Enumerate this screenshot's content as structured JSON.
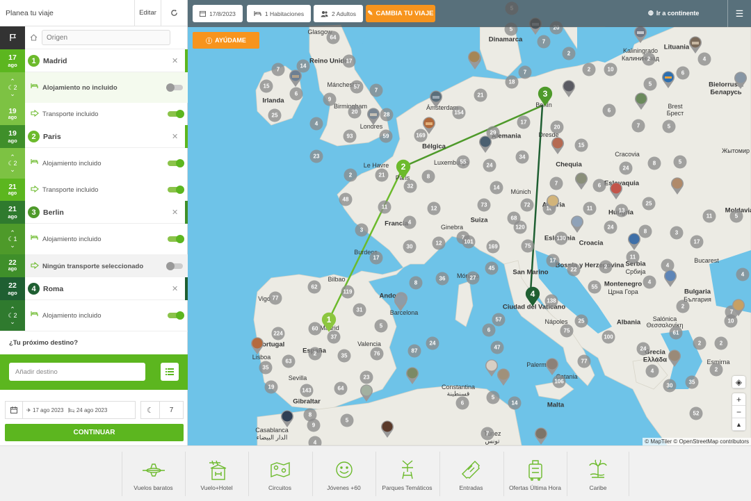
{
  "sidebar": {
    "title": "Planea tu viaje",
    "edit_label": "Editar",
    "origin_placeholder": "Origen",
    "stops": [
      {
        "num": "1",
        "name": "Madrid",
        "day": "17",
        "month": "ago",
        "accommodation": "Alojamiento no incluido",
        "accommodation_on": false,
        "nights": "2",
        "transport": "Transporte incluido",
        "transport_on": true,
        "transport_day": "19",
        "transport_month": "ago"
      },
      {
        "num": "2",
        "name": "Paris",
        "day": "19",
        "month": "ago",
        "accommodation": "Alojamiento incluido",
        "accommodation_on": true,
        "nights": "2",
        "transport": "Transporte incluido",
        "transport_on": true,
        "transport_day": "21",
        "transport_month": "ago"
      },
      {
        "num": "3",
        "name": "Berlin",
        "day": "21",
        "month": "ago",
        "accommodation": "Alojamiento incluido",
        "accommodation_on": true,
        "nights": "1",
        "transport": "Ningún transporte seleccionado",
        "transport_on": false,
        "transport_day": "22",
        "transport_month": "ago"
      },
      {
        "num": "4",
        "name": "Roma",
        "day": "22",
        "month": "ago",
        "accommodation": "Alojamiento incluido",
        "accommodation_on": true,
        "nights": "2"
      }
    ],
    "next_destination_label": "¿Tu próximo destino?",
    "add_destination_placeholder": "Añadir destino",
    "start_date": "17 ago 2023",
    "end_date": "24 ago 2023",
    "nights_total": "7",
    "continue_label": "CONTINUAR"
  },
  "topbar": {
    "date": "17/8/2023",
    "rooms": "1 Habitaciones",
    "adults": "2 Adultos",
    "change_trip": "CAMBIA TU VIAJE",
    "go_continent": "Ir a continente",
    "help": "AYÚDAME"
  },
  "map": {
    "attribution": "© MapTiler © OpenStreetMap contributors",
    "route_pins": [
      "1",
      "2",
      "3",
      "4"
    ],
    "labels": [
      "Glasgow",
      "Reino Unido",
      "Irlanda",
      "Mánchester",
      "Birmingham",
      "Londres",
      "Dinamarca",
      "Kaliningrado",
      "Калининград",
      "Lituania",
      "Bielorrusia",
      "Беларусь",
      "Brest",
      "Брест",
      "Ámsterdam",
      "Bélgica",
      "Alemania",
      "Berlín",
      "Dresde",
      "Cracovia",
      "Chequia",
      "Жытомир",
      "Le Havre",
      "Paris",
      "Luxemburgo",
      "Francia",
      "Múnich",
      "Austria",
      "Eslovaquia",
      "Hungría",
      "Ginebra",
      "Suiza",
      "Eslovenia",
      "Croacia",
      "Bosnia y Herzegovina",
      "Serbia",
      "Србија",
      "Bucarest",
      "Moldavia",
      "Burdeos",
      "Mónaco",
      "San Marino",
      "Montenegro",
      "Црна Гора",
      "Bulgaria",
      "България",
      "Bilbao",
      "Andorra",
      "Vigo",
      "Portugal",
      "Lisboa",
      "Madrid",
      "España",
      "Valencia",
      "Barcelona",
      "Ciudad del Vaticano",
      "Nápoles",
      "Albania",
      "Salónica",
      "Θεσσαλονίκη",
      "Grecia",
      "Ελλάδα",
      "Esmirna",
      "Sevilla",
      "Gibraltar",
      "Constantina",
      "قسنطينة",
      "Palermo",
      "Catania",
      "Malta",
      "Casablanca",
      "الدار البيضاء",
      "Túnez",
      "تونس"
    ]
  },
  "categories": [
    "Vuelos baratos",
    "Vuelo+Hotel",
    "Circuitos",
    "Jóvenes +60",
    "Parques Temáticos",
    "Entradas",
    "Ofertas Última Hora",
    "Caribe"
  ],
  "colors": {
    "green": "#5cb61f",
    "green_light": "#7dc243",
    "green_dark": "#1f5f32",
    "route_green": "#6cba2c",
    "orange": "#f7941d",
    "sea": "#6ec3e8",
    "land": "#ecebe4",
    "cluster": "#8c8c8c"
  }
}
